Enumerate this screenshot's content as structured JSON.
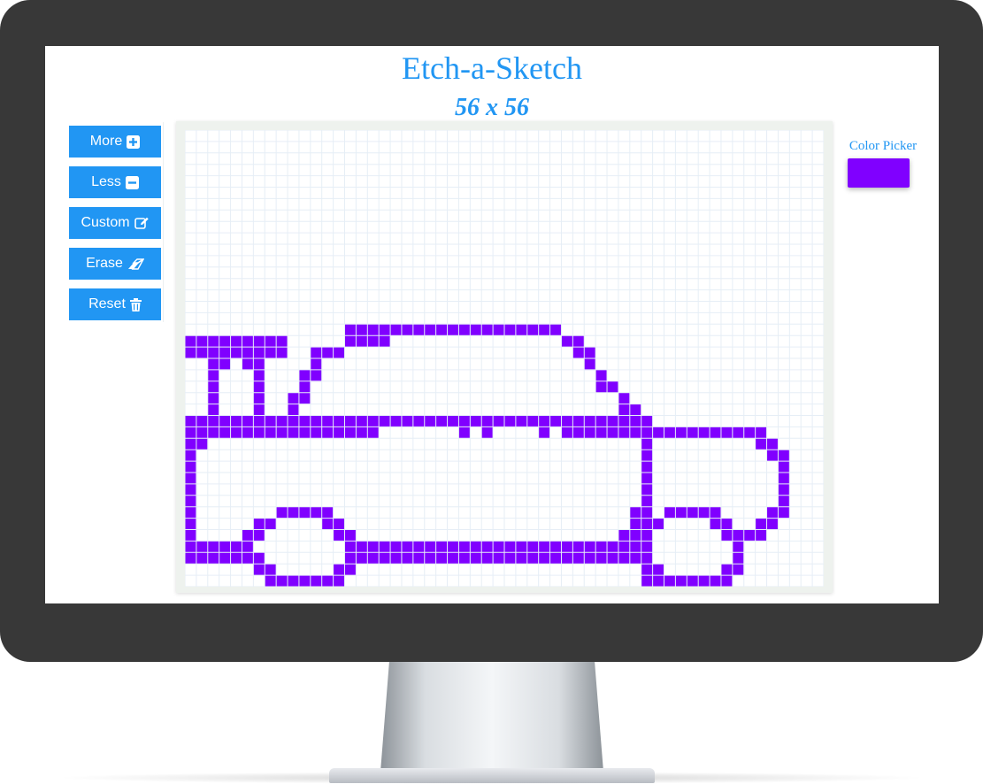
{
  "app": {
    "title": "Etch-a-Sketch",
    "grid_size_label": "56 x 56"
  },
  "buttons": [
    {
      "label": "More",
      "icon": "plus-square-icon"
    },
    {
      "label": "Less",
      "icon": "minus-square-icon"
    },
    {
      "label": "Custom",
      "icon": "edit-icon"
    },
    {
      "label": "Erase",
      "icon": "eraser-icon"
    },
    {
      "label": "Reset",
      "icon": "trash-icon"
    }
  ],
  "color_picker": {
    "label": "Color Picker",
    "value": "#8000ff"
  },
  "grid": {
    "columns": 56,
    "rows": 40,
    "paint_color": "#8000ff",
    "painted_cells": [
      [
        0,
        18
      ],
      [
        1,
        18
      ],
      [
        2,
        18
      ],
      [
        3,
        18
      ],
      [
        4,
        18
      ],
      [
        5,
        18
      ],
      [
        6,
        18
      ],
      [
        7,
        18
      ],
      [
        8,
        18
      ],
      [
        0,
        19
      ],
      [
        1,
        19
      ],
      [
        2,
        19
      ],
      [
        3,
        19
      ],
      [
        4,
        19
      ],
      [
        5,
        19
      ],
      [
        6,
        19
      ],
      [
        7,
        19
      ],
      [
        8,
        19
      ],
      [
        2,
        20
      ],
      [
        3,
        20
      ],
      [
        5,
        20
      ],
      [
        6,
        20
      ],
      [
        2,
        21
      ],
      [
        6,
        21
      ],
      [
        2,
        22
      ],
      [
        6,
        22
      ],
      [
        2,
        23
      ],
      [
        6,
        23
      ],
      [
        2,
        24
      ],
      [
        6,
        24
      ],
      [
        14,
        18
      ],
      [
        15,
        18
      ],
      [
        16,
        18
      ],
      [
        17,
        18
      ],
      [
        11,
        19
      ],
      [
        12,
        19
      ],
      [
        13,
        19
      ],
      [
        11,
        20
      ],
      [
        10,
        21
      ],
      [
        11,
        21
      ],
      [
        10,
        22
      ],
      [
        9,
        23
      ],
      [
        10,
        23
      ],
      [
        9,
        24
      ],
      [
        14,
        17
      ],
      [
        15,
        17
      ],
      [
        16,
        17
      ],
      [
        17,
        17
      ],
      [
        18,
        17
      ],
      [
        19,
        17
      ],
      [
        20,
        17
      ],
      [
        21,
        17
      ],
      [
        22,
        17
      ],
      [
        23,
        17
      ],
      [
        24,
        17
      ],
      [
        25,
        17
      ],
      [
        26,
        17
      ],
      [
        27,
        17
      ],
      [
        28,
        17
      ],
      [
        29,
        17
      ],
      [
        30,
        17
      ],
      [
        31,
        17
      ],
      [
        32,
        17
      ],
      [
        33,
        18
      ],
      [
        34,
        18
      ],
      [
        34,
        19
      ],
      [
        35,
        19
      ],
      [
        35,
        20
      ],
      [
        36,
        21
      ],
      [
        36,
        22
      ],
      [
        37,
        22
      ],
      [
        38,
        23
      ],
      [
        38,
        24
      ],
      [
        39,
        24
      ],
      [
        0,
        25
      ],
      [
        1,
        25
      ],
      [
        2,
        25
      ],
      [
        3,
        25
      ],
      [
        4,
        25
      ],
      [
        5,
        25
      ],
      [
        6,
        25
      ],
      [
        7,
        25
      ],
      [
        8,
        25
      ],
      [
        9,
        25
      ],
      [
        10,
        25
      ],
      [
        11,
        25
      ],
      [
        12,
        25
      ],
      [
        13,
        25
      ],
      [
        14,
        25
      ],
      [
        15,
        25
      ],
      [
        16,
        25
      ],
      [
        17,
        25
      ],
      [
        18,
        25
      ],
      [
        19,
        25
      ],
      [
        20,
        25
      ],
      [
        21,
        25
      ],
      [
        22,
        25
      ],
      [
        23,
        25
      ],
      [
        24,
        25
      ],
      [
        25,
        25
      ],
      [
        26,
        25
      ],
      [
        27,
        25
      ],
      [
        28,
        25
      ],
      [
        29,
        25
      ],
      [
        30,
        25
      ],
      [
        31,
        25
      ],
      [
        32,
        25
      ],
      [
        33,
        25
      ],
      [
        34,
        25
      ],
      [
        35,
        25
      ],
      [
        36,
        25
      ],
      [
        37,
        25
      ],
      [
        38,
        25
      ],
      [
        39,
        25
      ],
      [
        40,
        25
      ],
      [
        0,
        26
      ],
      [
        1,
        26
      ],
      [
        2,
        26
      ],
      [
        3,
        26
      ],
      [
        4,
        26
      ],
      [
        5,
        26
      ],
      [
        6,
        26
      ],
      [
        7,
        26
      ],
      [
        8,
        26
      ],
      [
        9,
        26
      ],
      [
        10,
        26
      ],
      [
        11,
        26
      ],
      [
        12,
        26
      ],
      [
        13,
        26
      ],
      [
        14,
        26
      ],
      [
        15,
        26
      ],
      [
        16,
        26
      ],
      [
        24,
        26
      ],
      [
        26,
        26
      ],
      [
        31,
        26
      ],
      [
        33,
        26
      ],
      [
        34,
        26
      ],
      [
        35,
        26
      ],
      [
        36,
        26
      ],
      [
        37,
        26
      ],
      [
        38,
        26
      ],
      [
        39,
        26
      ],
      [
        40,
        26
      ],
      [
        41,
        26
      ],
      [
        42,
        26
      ],
      [
        43,
        26
      ],
      [
        44,
        26
      ],
      [
        45,
        26
      ],
      [
        46,
        26
      ],
      [
        47,
        26
      ],
      [
        48,
        26
      ],
      [
        49,
        26
      ],
      [
        50,
        26
      ],
      [
        0,
        27
      ],
      [
        1,
        27
      ],
      [
        40,
        27
      ],
      [
        50,
        27
      ],
      [
        51,
        27
      ],
      [
        0,
        28
      ],
      [
        40,
        28
      ],
      [
        51,
        28
      ],
      [
        52,
        28
      ],
      [
        0,
        29
      ],
      [
        40,
        29
      ],
      [
        52,
        29
      ],
      [
        0,
        30
      ],
      [
        40,
        30
      ],
      [
        52,
        30
      ],
      [
        0,
        31
      ],
      [
        40,
        31
      ],
      [
        52,
        31
      ],
      [
        0,
        32
      ],
      [
        40,
        32
      ],
      [
        52,
        32
      ],
      [
        0,
        33
      ],
      [
        8,
        33
      ],
      [
        9,
        33
      ],
      [
        10,
        33
      ],
      [
        11,
        33
      ],
      [
        12,
        33
      ],
      [
        39,
        33
      ],
      [
        40,
        33
      ],
      [
        42,
        33
      ],
      [
        43,
        33
      ],
      [
        44,
        33
      ],
      [
        45,
        33
      ],
      [
        46,
        33
      ],
      [
        51,
        33
      ],
      [
        52,
        33
      ],
      [
        0,
        34
      ],
      [
        6,
        34
      ],
      [
        7,
        34
      ],
      [
        12,
        34
      ],
      [
        13,
        34
      ],
      [
        39,
        34
      ],
      [
        40,
        34
      ],
      [
        41,
        34
      ],
      [
        46,
        34
      ],
      [
        47,
        34
      ],
      [
        50,
        34
      ],
      [
        51,
        34
      ],
      [
        0,
        35
      ],
      [
        5,
        35
      ],
      [
        6,
        35
      ],
      [
        13,
        35
      ],
      [
        14,
        35
      ],
      [
        38,
        35
      ],
      [
        39,
        35
      ],
      [
        40,
        35
      ],
      [
        47,
        35
      ],
      [
        48,
        35
      ],
      [
        49,
        35
      ],
      [
        50,
        35
      ],
      [
        0,
        36
      ],
      [
        1,
        36
      ],
      [
        2,
        36
      ],
      [
        3,
        36
      ],
      [
        4,
        36
      ],
      [
        5,
        36
      ],
      [
        14,
        36
      ],
      [
        15,
        36
      ],
      [
        16,
        36
      ],
      [
        17,
        36
      ],
      [
        18,
        36
      ],
      [
        19,
        36
      ],
      [
        20,
        36
      ],
      [
        21,
        36
      ],
      [
        22,
        36
      ],
      [
        23,
        36
      ],
      [
        24,
        36
      ],
      [
        25,
        36
      ],
      [
        26,
        36
      ],
      [
        27,
        36
      ],
      [
        28,
        36
      ],
      [
        29,
        36
      ],
      [
        30,
        36
      ],
      [
        31,
        36
      ],
      [
        32,
        36
      ],
      [
        33,
        36
      ],
      [
        34,
        36
      ],
      [
        35,
        36
      ],
      [
        36,
        36
      ],
      [
        37,
        36
      ],
      [
        38,
        36
      ],
      [
        39,
        36
      ],
      [
        40,
        36
      ],
      [
        48,
        36
      ],
      [
        0,
        37
      ],
      [
        1,
        37
      ],
      [
        2,
        37
      ],
      [
        3,
        37
      ],
      [
        4,
        37
      ],
      [
        5,
        37
      ],
      [
        6,
        37
      ],
      [
        14,
        37
      ],
      [
        15,
        37
      ],
      [
        16,
        37
      ],
      [
        17,
        37
      ],
      [
        18,
        37
      ],
      [
        19,
        37
      ],
      [
        20,
        37
      ],
      [
        21,
        37
      ],
      [
        22,
        37
      ],
      [
        23,
        37
      ],
      [
        24,
        37
      ],
      [
        25,
        37
      ],
      [
        26,
        37
      ],
      [
        27,
        37
      ],
      [
        28,
        37
      ],
      [
        29,
        37
      ],
      [
        30,
        37
      ],
      [
        31,
        37
      ],
      [
        32,
        37
      ],
      [
        33,
        37
      ],
      [
        34,
        37
      ],
      [
        35,
        37
      ],
      [
        36,
        37
      ],
      [
        37,
        37
      ],
      [
        38,
        37
      ],
      [
        39,
        37
      ],
      [
        40,
        37
      ],
      [
        48,
        37
      ],
      [
        6,
        38
      ],
      [
        7,
        38
      ],
      [
        13,
        38
      ],
      [
        14,
        38
      ],
      [
        40,
        38
      ],
      [
        41,
        38
      ],
      [
        47,
        38
      ],
      [
        48,
        38
      ],
      [
        7,
        39
      ],
      [
        8,
        39
      ],
      [
        9,
        39
      ],
      [
        10,
        39
      ],
      [
        11,
        39
      ],
      [
        12,
        39
      ],
      [
        13,
        39
      ],
      [
        40,
        39
      ],
      [
        41,
        39
      ],
      [
        42,
        39
      ],
      [
        43,
        39
      ],
      [
        44,
        39
      ],
      [
        45,
        39
      ],
      [
        46,
        39
      ],
      [
        47,
        39
      ]
    ]
  }
}
